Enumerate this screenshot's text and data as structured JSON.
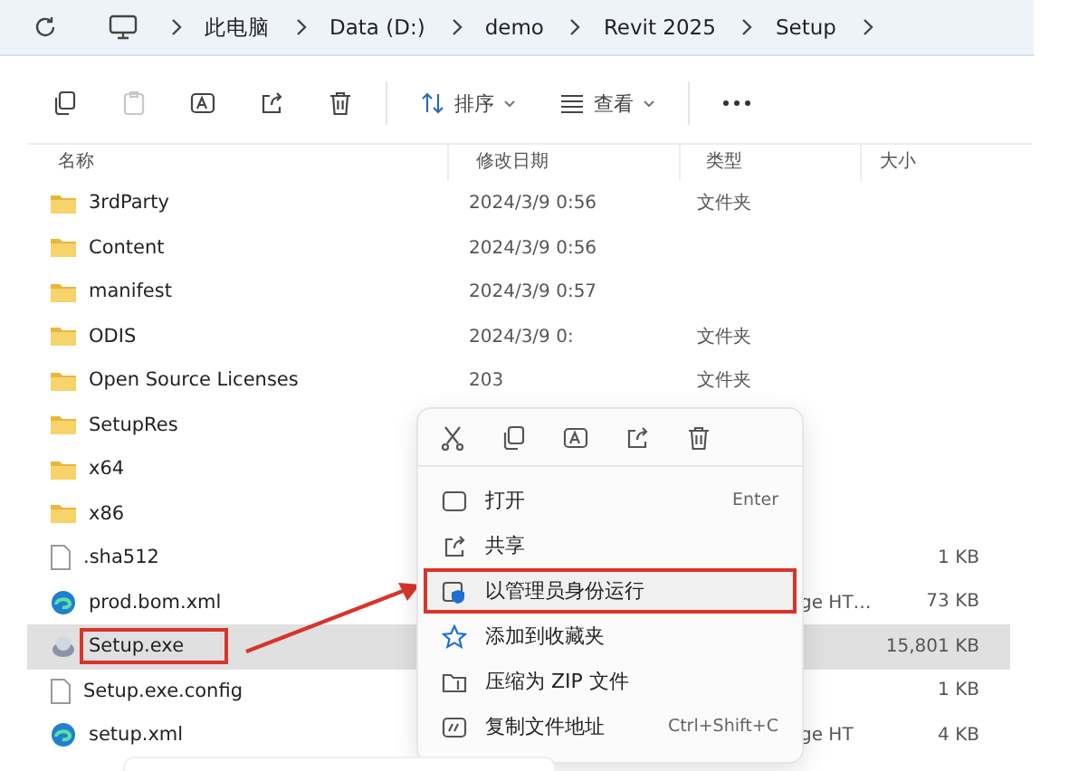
{
  "address_bar": {
    "segments": [
      "此电脑",
      "Data (D:)",
      "demo",
      "Revit 2025",
      "Setup"
    ]
  },
  "toolbar": {
    "buttons": [
      {
        "kind": "copy",
        "disabled": false
      },
      {
        "kind": "paste",
        "disabled": true
      },
      {
        "kind": "rename",
        "disabled": false
      },
      {
        "kind": "share",
        "disabled": false
      },
      {
        "kind": "delete",
        "disabled": false
      }
    ],
    "sort_label": "排序",
    "view_label": "查看"
  },
  "columns": [
    "名称",
    "修改日期",
    "类型",
    "大小"
  ],
  "files": [
    {
      "kind": "folder",
      "name": "3rdParty",
      "date": "2024/3/9 0:56",
      "type": "文件夹",
      "selected": false,
      "marked": false
    },
    {
      "kind": "folder",
      "name": "Content",
      "date": "2024/3/9 0:56",
      "selected": false,
      "marked": false
    },
    {
      "kind": "folder",
      "name": "manifest",
      "date": "2024/3/9 0:57",
      "selected": false,
      "marked": false
    },
    {
      "kind": "folder",
      "name": "ODIS",
      "date": "2024/3/9 0:",
      "type": "文件夹",
      "selected": false,
      "marked": false
    },
    {
      "kind": "folder",
      "name": "Open Source Licenses",
      "date": "203",
      "type": "文件夹",
      "selected": false,
      "marked": false
    },
    {
      "kind": "folder",
      "name": "SetupRes",
      "selected": false,
      "marked": false
    },
    {
      "kind": "folder",
      "name": "x64",
      "selected": false,
      "marked": false
    },
    {
      "kind": "folder",
      "name": "x86",
      "selected": false,
      "marked": false
    },
    {
      "kind": "file",
      "name": ".sha512",
      "size": "1 KB",
      "selected": false,
      "marked": false
    },
    {
      "kind": "edge",
      "name": "prod.bom.xml",
      "type": "ge HT…",
      "covered": true,
      "size": "73 KB",
      "selected": false,
      "marked": false
    },
    {
      "kind": "setup",
      "name": "Setup.exe",
      "size": "15,801 KB",
      "selected": true,
      "marked": true
    },
    {
      "kind": "file",
      "name": "Setup.exe.config",
      "size": "1 KB",
      "selected": false,
      "marked": false
    },
    {
      "kind": "edge",
      "name": "setup.xml",
      "type": "ge HT",
      "covered": true,
      "size": "4 KB",
      "selected": false,
      "marked": false
    }
  ],
  "context_menu": {
    "quick_actions": [
      {
        "kind": "cut"
      },
      {
        "kind": "copy"
      },
      {
        "kind": "rename"
      },
      {
        "kind": "share"
      },
      {
        "kind": "delete"
      }
    ],
    "items": [
      {
        "kind": "open",
        "label": "打开",
        "shortcut": "Enter",
        "marked": false
      },
      {
        "kind": "share",
        "label": "共享",
        "marked": false
      },
      {
        "kind": "admin",
        "label": "以管理员身份运行",
        "marked": true
      },
      {
        "kind": "favorite",
        "label": "添加到收藏夹",
        "marked": false
      },
      {
        "kind": "zip",
        "label": "压缩为 ZIP 文件",
        "marked": false
      },
      {
        "kind": "copy-path",
        "label": "复制文件地址",
        "shortcut": "Ctrl+Shift+C",
        "marked": false
      }
    ]
  }
}
